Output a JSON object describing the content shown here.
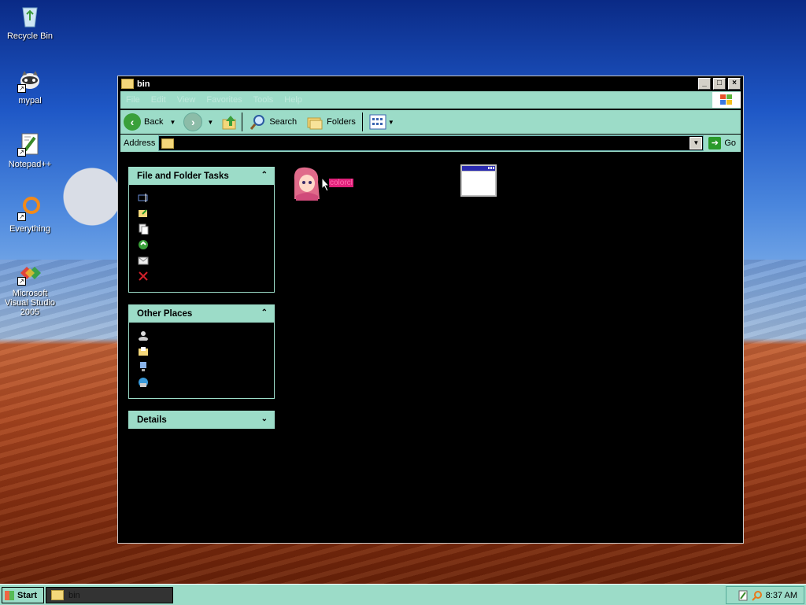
{
  "desktop": {
    "icons": [
      {
        "label": "Recycle Bin"
      },
      {
        "label": "mypal"
      },
      {
        "label": "Notepad++"
      },
      {
        "label": "Everything"
      },
      {
        "label": "Microsoft Visual Studio 2005"
      }
    ]
  },
  "window": {
    "title": "bin",
    "menu": [
      "File",
      "Edit",
      "View",
      "Favorites",
      "Tools",
      "Help"
    ],
    "toolbar": {
      "back_label": "Back",
      "search_label": "Search",
      "folders_label": "Folders"
    },
    "address": {
      "label": "Address",
      "value": "",
      "go_label": "Go"
    },
    "panels": {
      "tasks_title": "File and Folder Tasks",
      "other_title": "Other Places",
      "details_title": "Details"
    },
    "files": [
      {
        "name": "colorcl"
      },
      {
        "name": ""
      }
    ]
  },
  "taskbar": {
    "start_label": "Start",
    "task_label": "bin",
    "clock": "8:37 AM"
  }
}
